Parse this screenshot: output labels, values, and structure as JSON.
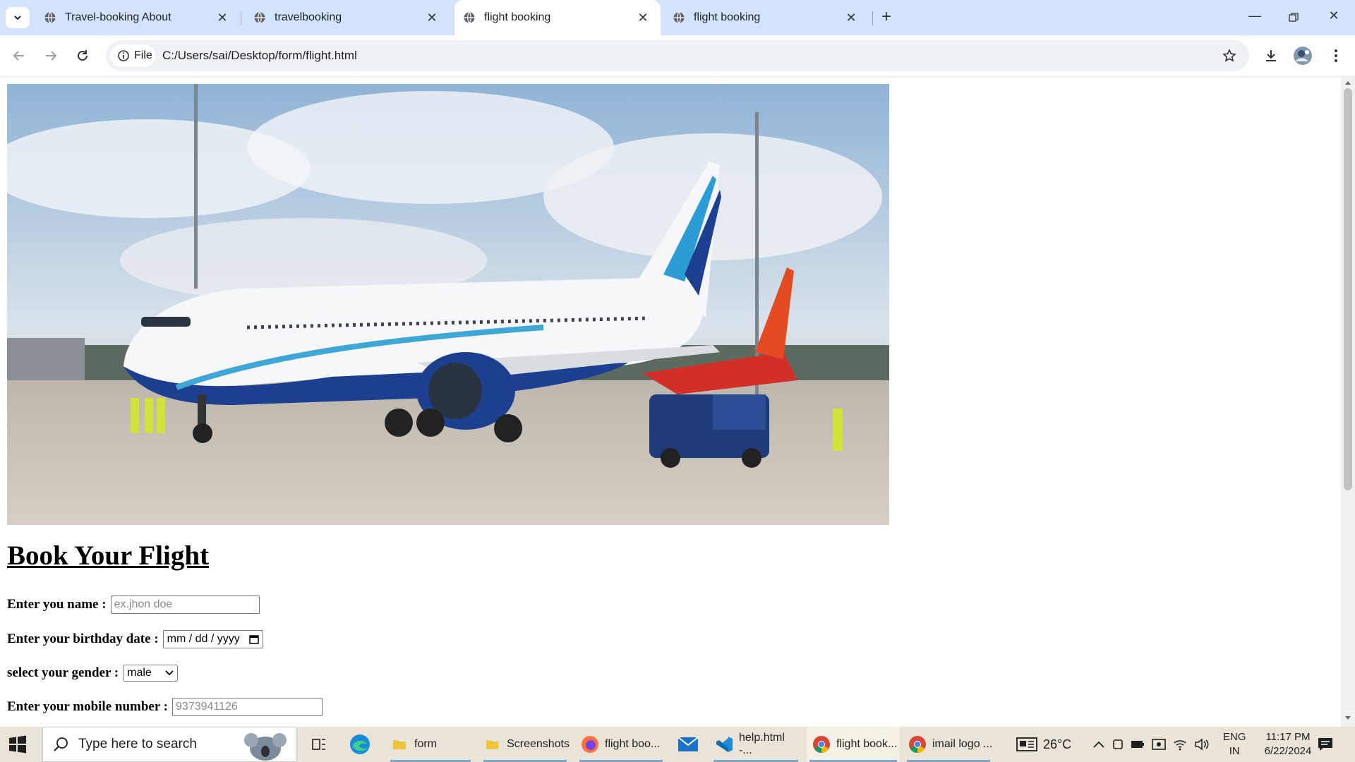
{
  "tabs": [
    {
      "title": "Travel-booking About",
      "active": false
    },
    {
      "title": "travelbooking",
      "active": false
    },
    {
      "title": "flight booking",
      "active": true
    },
    {
      "title": "flight booking",
      "active": false
    }
  ],
  "address_bar": {
    "chip_label": "File",
    "url": "C:/Users/sai/Desktop/form/flight.html"
  },
  "page": {
    "heading": "Book Your Flight",
    "name_label": "Enter you name :",
    "name_placeholder": "ex.jhon doe",
    "birthday_label": "Enter your birthday date :",
    "birthday_placeholder": "mm / dd / yyyy",
    "gender_label": "select your gender :",
    "gender_value": "male",
    "mobile_label": "Enter your mobile number :",
    "mobile_placeholder": "9373941126"
  },
  "taskbar": {
    "search_placeholder": "Type here to search",
    "apps": [
      {
        "label": "form",
        "icon": "folder-icon"
      },
      {
        "label": "Screenshots",
        "icon": "folder-icon"
      },
      {
        "label": "flight boo...",
        "icon": "firefox-icon"
      },
      {
        "label": "help.html -...",
        "icon": "vscode-icon"
      },
      {
        "label": "flight book...",
        "icon": "chrome-icon"
      },
      {
        "label": "imail logo ...",
        "icon": "chrome-icon"
      }
    ],
    "weather": "26°C",
    "lang_top": "ENG",
    "lang_bottom": "IN",
    "time": "11:17 PM",
    "date": "6/22/2024"
  },
  "colors": {
    "tabstrip": "#d3e3fd",
    "taskbar": "#e9e3d8",
    "accent": "#0b57d0"
  }
}
